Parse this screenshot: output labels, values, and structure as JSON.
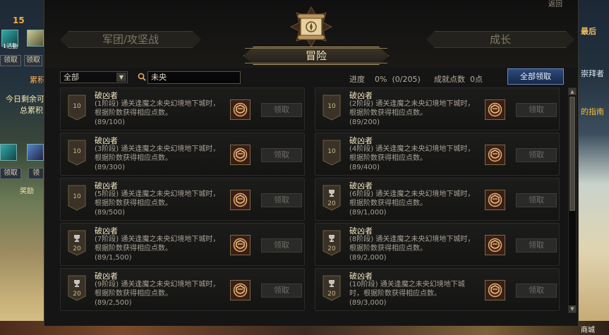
{
  "hud_left": {
    "level_number": "15",
    "badge_label": "1活動",
    "claim_btn_1": "领取",
    "claim_btn_2": "领取",
    "claim_btn_3": "领",
    "cumulative_label": "累积",
    "today_remaining": "今日剩余可",
    "total_cumulative": "总累积",
    "mail_label": "奖励"
  },
  "hud_right": {
    "last_label": "最后",
    "worship_label": "崇拜者",
    "guide_label": "的指南",
    "shop_label": "商城"
  },
  "window": {
    "back_label": "返回",
    "tabs": [
      {
        "label": "军团/攻坚战",
        "active": false
      },
      {
        "label": "冒险",
        "active": true
      },
      {
        "label": "成长",
        "active": false
      }
    ]
  },
  "toolbar": {
    "filter_selected": "全部",
    "search_value": "未央",
    "progress_label": "进度",
    "progress_value": "0%",
    "progress_count": "(0/205)",
    "points_label": "成就点数",
    "points_value": "0点",
    "claim_all_label": "全部领取"
  },
  "achievements": [
    {
      "title": "破凶者",
      "desc": "(1阶段) 通关逢魔之未央幻境地下城时，根据阶数获得相应点数。",
      "progress": "(89/100)",
      "badge_value": "10",
      "badge_type": "plain",
      "claim_label": "领取"
    },
    {
      "title": "破凶者",
      "desc": "(2阶段) 通关逢魔之未央幻境地下城时，根据阶数获得相应点数。",
      "progress": "(89/200)",
      "badge_value": "10",
      "badge_type": "plain",
      "claim_label": "领取"
    },
    {
      "title": "破凶者",
      "desc": "(3阶段) 通关逢魔之未央幻境地下城时，根据阶数获得相应点数。",
      "progress": "(89/300)",
      "badge_value": "10",
      "badge_type": "plain",
      "claim_label": "领取"
    },
    {
      "title": "破凶者",
      "desc": "(4阶段) 通关逢魔之未央幻境地下城时，根据阶数获得相应点数。",
      "progress": "(89/400)",
      "badge_value": "10",
      "badge_type": "plain",
      "claim_label": "领取"
    },
    {
      "title": "破凶者",
      "desc": "(5阶段) 通关逢魔之未央幻境地下城时，根据阶数获得相应点数。",
      "progress": "(89/500)",
      "badge_value": "10",
      "badge_type": "plain",
      "claim_label": "领取"
    },
    {
      "title": "破凶者",
      "desc": "(6阶段) 通关逢魔之未央幻境地下城时，根据阶数获得相应点数。",
      "progress": "(89/1,000)",
      "badge_value": "20",
      "badge_type": "trophy",
      "claim_label": "领取"
    },
    {
      "title": "破凶者",
      "desc": "(7阶段) 通关逢魔之未央幻境地下城时，根据阶数获得相应点数。",
      "progress": "(89/1,500)",
      "badge_value": "20",
      "badge_type": "trophy",
      "claim_label": "领取"
    },
    {
      "title": "破凶者",
      "desc": "(8阶段) 通关逢魔之未央幻境地下城时，根据阶数获得相应点数。",
      "progress": "(89/2,000)",
      "badge_value": "20",
      "badge_type": "trophy",
      "claim_label": "领取"
    },
    {
      "title": "破凶者",
      "desc": "(9阶段) 通关逢魔之未央幻境地下城时，根据阶数获得相应点数。",
      "progress": "(89/2,500)",
      "badge_value": "20",
      "badge_type": "trophy",
      "claim_label": "领取"
    },
    {
      "title": "破凶者",
      "desc": "(10阶段) 通关逢魔之未央幻境地下城时，根据阶数获得相应点数。",
      "progress": "(89/3,000)",
      "badge_value": "20",
      "badge_type": "trophy",
      "claim_label": "领取"
    }
  ],
  "colors": {
    "panel_bg": "#151515",
    "accent_gold": "#b5a070",
    "claim_all_blue": "#2e4a7a"
  }
}
